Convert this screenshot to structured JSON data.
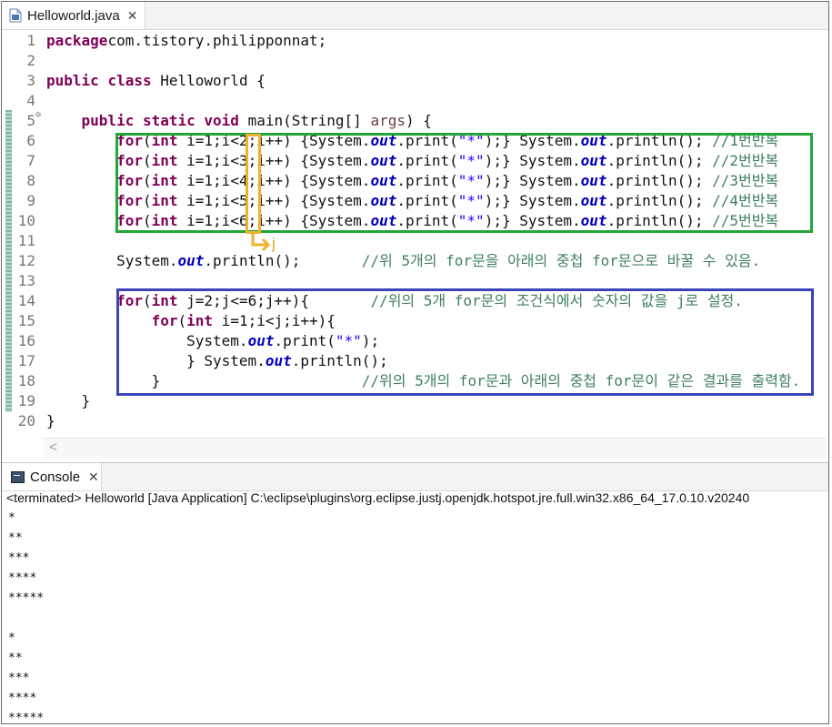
{
  "editor": {
    "tab_label": "Helloworld.java",
    "lines": [
      {
        "n": "1",
        "tokens": [
          [
            "kw",
            "package"
          ],
          [
            "",
            "com.tistory.philipponnat;"
          ]
        ]
      },
      {
        "n": "2",
        "tokens": []
      },
      {
        "n": "3",
        "tokens": [
          [
            "kw",
            "public"
          ],
          [
            "",
            " "
          ],
          [
            "kw",
            "class"
          ],
          [
            "",
            " Helloworld {"
          ]
        ]
      },
      {
        "n": "4",
        "tokens": []
      },
      {
        "n": "5",
        "tokens": [
          [
            "",
            "    "
          ],
          [
            "kw",
            "public"
          ],
          [
            "",
            " "
          ],
          [
            "kw",
            "static"
          ],
          [
            "",
            " "
          ],
          [
            "kw",
            "void"
          ],
          [
            "",
            " main(String[] "
          ],
          [
            "par",
            "args"
          ],
          [
            "",
            ") {"
          ]
        ]
      },
      {
        "n": "6",
        "tokens": [
          [
            "",
            "        "
          ],
          [
            "kw",
            "for"
          ],
          [
            "",
            "("
          ],
          [
            "kw",
            "int"
          ],
          [
            "",
            " i=1;i<2;i++) {System."
          ],
          [
            "fld",
            "out"
          ],
          [
            "",
            ".print("
          ],
          [
            "str",
            "\"*\""
          ],
          [
            "",
            ");} System."
          ],
          [
            "fld",
            "out"
          ],
          [
            "",
            ".println(); "
          ],
          [
            "cmt",
            "//1번반복"
          ]
        ]
      },
      {
        "n": "7",
        "tokens": [
          [
            "",
            "        "
          ],
          [
            "kw",
            "for"
          ],
          [
            "",
            "("
          ],
          [
            "kw",
            "int"
          ],
          [
            "",
            " i=1;i<3;i++) {System."
          ],
          [
            "fld",
            "out"
          ],
          [
            "",
            ".print("
          ],
          [
            "str",
            "\"*\""
          ],
          [
            "",
            ");} System."
          ],
          [
            "fld",
            "out"
          ],
          [
            "",
            ".println(); "
          ],
          [
            "cmt",
            "//2번반복"
          ]
        ]
      },
      {
        "n": "8",
        "tokens": [
          [
            "",
            "        "
          ],
          [
            "kw",
            "for"
          ],
          [
            "",
            "("
          ],
          [
            "kw",
            "int"
          ],
          [
            "",
            " i=1;i<4;i++) {System."
          ],
          [
            "fld",
            "out"
          ],
          [
            "",
            ".print("
          ],
          [
            "str",
            "\"*\""
          ],
          [
            "",
            ");} System."
          ],
          [
            "fld",
            "out"
          ],
          [
            "",
            ".println(); "
          ],
          [
            "cmt",
            "//3번반복"
          ]
        ]
      },
      {
        "n": "9",
        "tokens": [
          [
            "",
            "        "
          ],
          [
            "kw",
            "for"
          ],
          [
            "",
            "("
          ],
          [
            "kw",
            "int"
          ],
          [
            "",
            " i=1;i<5;i++) {System."
          ],
          [
            "fld",
            "out"
          ],
          [
            "",
            ".print("
          ],
          [
            "str",
            "\"*\""
          ],
          [
            "",
            ");} System."
          ],
          [
            "fld",
            "out"
          ],
          [
            "",
            ".println(); "
          ],
          [
            "cmt",
            "//4번반복"
          ]
        ]
      },
      {
        "n": "10",
        "tokens": [
          [
            "",
            "        "
          ],
          [
            "kw",
            "for"
          ],
          [
            "",
            "("
          ],
          [
            "kw",
            "int"
          ],
          [
            "",
            " i=1;i<6;i++) {System."
          ],
          [
            "fld",
            "out"
          ],
          [
            "",
            ".print("
          ],
          [
            "str",
            "\"*\""
          ],
          [
            "",
            ");} System."
          ],
          [
            "fld",
            "out"
          ],
          [
            "",
            ".println(); "
          ],
          [
            "cmt",
            "//5번반복"
          ]
        ]
      },
      {
        "n": "11",
        "tokens": []
      },
      {
        "n": "12",
        "tokens": [
          [
            "",
            "        System."
          ],
          [
            "fld",
            "out"
          ],
          [
            "",
            ".println();       "
          ],
          [
            "cmt",
            "//위 5개의 for문을 아래의 중첩 for문으로 바꿀 수 있음."
          ]
        ]
      },
      {
        "n": "13",
        "tokens": []
      },
      {
        "n": "14",
        "tokens": [
          [
            "",
            "        "
          ],
          [
            "kw",
            "for"
          ],
          [
            "",
            "("
          ],
          [
            "kw",
            "int"
          ],
          [
            "",
            " j=2;j<=6;j++){       "
          ],
          [
            "cmt",
            "//위의 5개 for문의 조건식에서 숫자의 값을 j로 설정."
          ]
        ]
      },
      {
        "n": "15",
        "tokens": [
          [
            "",
            "            "
          ],
          [
            "kw",
            "for"
          ],
          [
            "",
            "("
          ],
          [
            "kw",
            "int"
          ],
          [
            "",
            " i=1;i<j;i++){"
          ]
        ]
      },
      {
        "n": "16",
        "tokens": [
          [
            "",
            "                System."
          ],
          [
            "fld",
            "out"
          ],
          [
            "",
            ".print("
          ],
          [
            "str",
            "\"*\""
          ],
          [
            "",
            ");"
          ]
        ]
      },
      {
        "n": "17",
        "tokens": [
          [
            "",
            "                } System."
          ],
          [
            "fld",
            "out"
          ],
          [
            "",
            ".println();"
          ]
        ]
      },
      {
        "n": "18",
        "tokens": [
          [
            "",
            "            }                       "
          ],
          [
            "cmt",
            "//위의 5개의 for문과 아래의 중첩 for문이 같은 결과를 출력함."
          ]
        ]
      },
      {
        "n": "19",
        "tokens": [
          [
            "",
            "    }"
          ]
        ]
      },
      {
        "n": "20",
        "tokens": [
          [
            "",
            "}"
          ]
        ]
      }
    ],
    "annotation_label": "j"
  },
  "console": {
    "tab_label": "Console",
    "status": "<terminated> Helloworld [Java Application] C:\\eclipse\\plugins\\org.eclipse.justj.openjdk.hotspot.jre.full.win32.x86_64_17.0.10.v20240",
    "output": [
      "*",
      "**",
      "***",
      "****",
      "*****",
      "",
      "*",
      "**",
      "***",
      "****",
      "*****"
    ]
  },
  "icons": {
    "file": "java-file-icon",
    "close": "close-icon",
    "console": "console-icon",
    "fold": "fold-collapse-icon",
    "scroll": "scroll-left-icon"
  },
  "colors": {
    "keyword": "#7f0055",
    "field": "#0000c0",
    "string": "#2a00ff",
    "comment": "#3f7f5f",
    "green_box": "#22a63a",
    "blue_box": "#3a44b8",
    "orange_box": "#f0b12a"
  }
}
